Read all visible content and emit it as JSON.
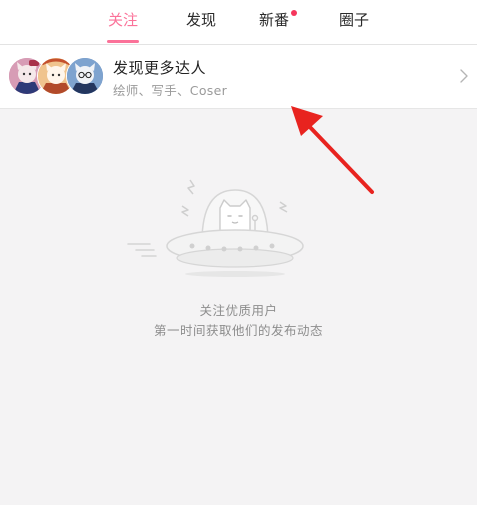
{
  "tabs": {
    "follow": "关注",
    "discover": "发现",
    "new_anime": "新番",
    "circles": "圈子"
  },
  "discover_card": {
    "title": "发现更多达人",
    "subtitle": "绘师、写手、Coser"
  },
  "empty_state": {
    "line1": "关注优质用户",
    "line2": "第一时间获取他们的发布动态"
  },
  "colors": {
    "accent": "#fb7299",
    "badge": "#f5365c",
    "annotation_arrow": "#e8231f"
  },
  "icons": {
    "chevron": "chevron-right-icon",
    "illustration": "ufo-cat-illustration"
  }
}
